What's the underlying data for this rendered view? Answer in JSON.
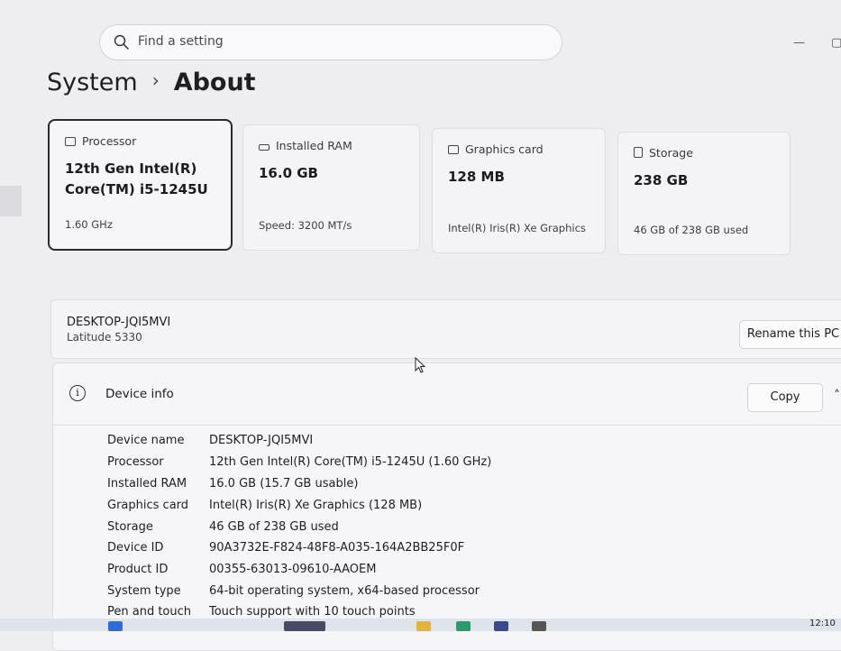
{
  "search": {
    "placeholder": "Find a setting"
  },
  "breadcrumb": {
    "parent": "System",
    "separator": "›",
    "current": "About"
  },
  "cards": [
    {
      "icon": "processor-icon",
      "label": "Processor",
      "value": "12th Gen Intel(R) Core(TM) i5-1245U",
      "sub": "1.60 GHz",
      "selected": true
    },
    {
      "icon": "ram-icon",
      "label": "Installed RAM",
      "value": "16.0 GB",
      "sub": "Speed: 3200 MT/s",
      "selected": false
    },
    {
      "icon": "graphics-card-icon",
      "label": "Graphics card",
      "value": "128 MB",
      "sub": "Intel(R) Iris(R) Xe Graphics",
      "selected": false
    },
    {
      "icon": "storage-icon",
      "label": "Storage",
      "value": "238 GB",
      "sub": "46 GB of 238 GB used",
      "selected": false
    }
  ],
  "pc": {
    "name": "DESKTOP-JQI5MVI",
    "model": "Latitude 5330",
    "rename_label": "Rename this PC"
  },
  "device_info": {
    "title": "Device info",
    "copy_label": "Copy",
    "rows": [
      {
        "key": "Device name",
        "value": "DESKTOP-JQI5MVI"
      },
      {
        "key": "Processor",
        "value": "12th Gen Intel(R) Core(TM) i5-1245U (1.60 GHz)"
      },
      {
        "key": "Installed RAM",
        "value": "16.0 GB (15.7 GB usable)"
      },
      {
        "key": "Graphics card",
        "value": "Intel(R) Iris(R) Xe Graphics (128 MB)"
      },
      {
        "key": "Storage",
        "value": "46 GB of 238 GB used"
      },
      {
        "key": "Device ID",
        "value": "90A3732E-F824-48F8-A035-164A2BB25F0F"
      },
      {
        "key": "Product ID",
        "value": "00355-63013-09610-AAOEM"
      },
      {
        "key": "System type",
        "value": "64-bit operating system, x64-based processor"
      },
      {
        "key": "Pen and touch",
        "value": "Touch support with 10 touch points"
      }
    ]
  },
  "taskbar": {
    "time": "12:10"
  }
}
